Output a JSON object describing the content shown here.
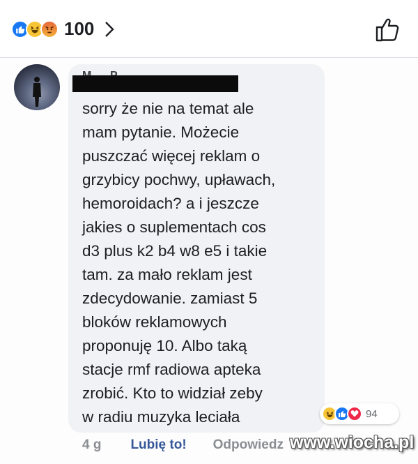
{
  "header": {
    "reactions": [
      "like",
      "haha",
      "angry"
    ],
    "reaction_count": "100"
  },
  "comment": {
    "text": "sorry że nie na temat ale\nmam pytanie. Możecie\npuszczać więcej reklam o\ngrzybicy pochwy, upławach,\nhemoroidach? a i jeszcze\njakies o suplementach cos\nd3 plus k2 b4 w8 e5 i takie\ntam. za mało reklam jest\nzdecydowanie. zamiast 5\nbloków reklamowych\nproponuję 10. Albo taką\nstacje rmf radiowa apteka\nzrobić. Kto to widział zeby\nw radiu muzyka leciała",
    "reactions": [
      "haha",
      "like",
      "love"
    ],
    "reaction_count": "94"
  },
  "actions": {
    "time": "4 g",
    "like": "Lubię to!",
    "reply": "Odpowiedz"
  },
  "watermark": "www.wiocha.pl"
}
